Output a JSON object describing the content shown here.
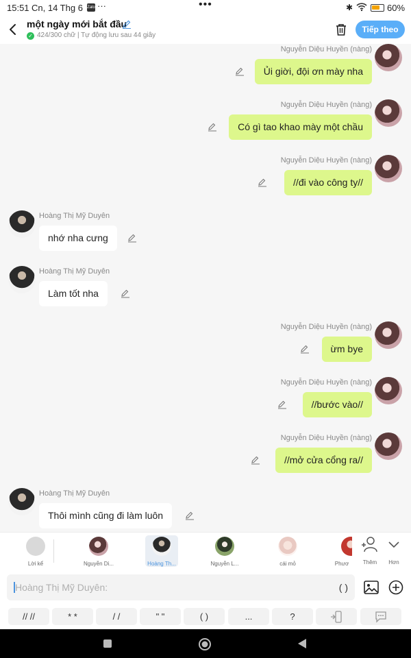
{
  "status_bar": {
    "time": "15:51",
    "date": "Cn, 14 Thg 6",
    "more": "···",
    "center": "•••",
    "battery": "60%"
  },
  "header": {
    "title": "một ngày mới bắt đầu",
    "subtitle": "424/300 chữ | Tự động lưu sau 44 giây",
    "next_label": "Tiếp theo"
  },
  "messages": [
    {
      "side": "right",
      "name": "Nguyễn Diệu Huyền (nàng)",
      "text": "Ủi giời, đội ơn mày nha"
    },
    {
      "side": "right",
      "name": "Nguyễn Diệu Huyền (nàng)",
      "text": "Có gì tao khao mày một chầu"
    },
    {
      "side": "right",
      "name": "Nguyễn Diệu Huyền (nàng)",
      "text": "//đi vào công ty//"
    },
    {
      "side": "left",
      "name": "Hoàng Thị Mỹ Duyên",
      "text": "nhớ nha cưng"
    },
    {
      "side": "left",
      "name": "Hoàng Thị Mỹ Duyên",
      "text": "Làm tốt nha"
    },
    {
      "side": "right",
      "name": "Nguyễn Diệu Huyền (nàng)",
      "text": "ừm bye"
    },
    {
      "side": "right",
      "name": "Nguyễn Diệu Huyền (nàng)",
      "text": "//bước vào//"
    },
    {
      "side": "right",
      "name": "Nguyễn Diệu Huyền (nàng)",
      "text": "//mở cửa cổng ra//"
    },
    {
      "side": "left",
      "name": "Hoàng Thị Mỹ Duyên",
      "text": "Thôi mình cũng đi làm luôn"
    }
  ],
  "characters": [
    {
      "name": "Lời kể"
    },
    {
      "name": "Nguyễn Di..."
    },
    {
      "name": "Hoàng Th..."
    },
    {
      "name": "Nguyễn L..."
    },
    {
      "name": "cái mỏ"
    },
    {
      "name": "Phươ"
    }
  ],
  "char_actions": {
    "more_label": "Thêm",
    "collapse_label": "Hơn"
  },
  "input": {
    "placeholder": "Hoàng Thị Mỹ Duyên:",
    "paren": "( )"
  },
  "quick_keys": [
    "// //",
    "* *",
    "/ /",
    "\" \"",
    "( )",
    "...",
    "?"
  ],
  "colors": {
    "accent": "#5aaef8",
    "bubble_right": "#ddf78c",
    "bubble_left": "#ffffff"
  }
}
